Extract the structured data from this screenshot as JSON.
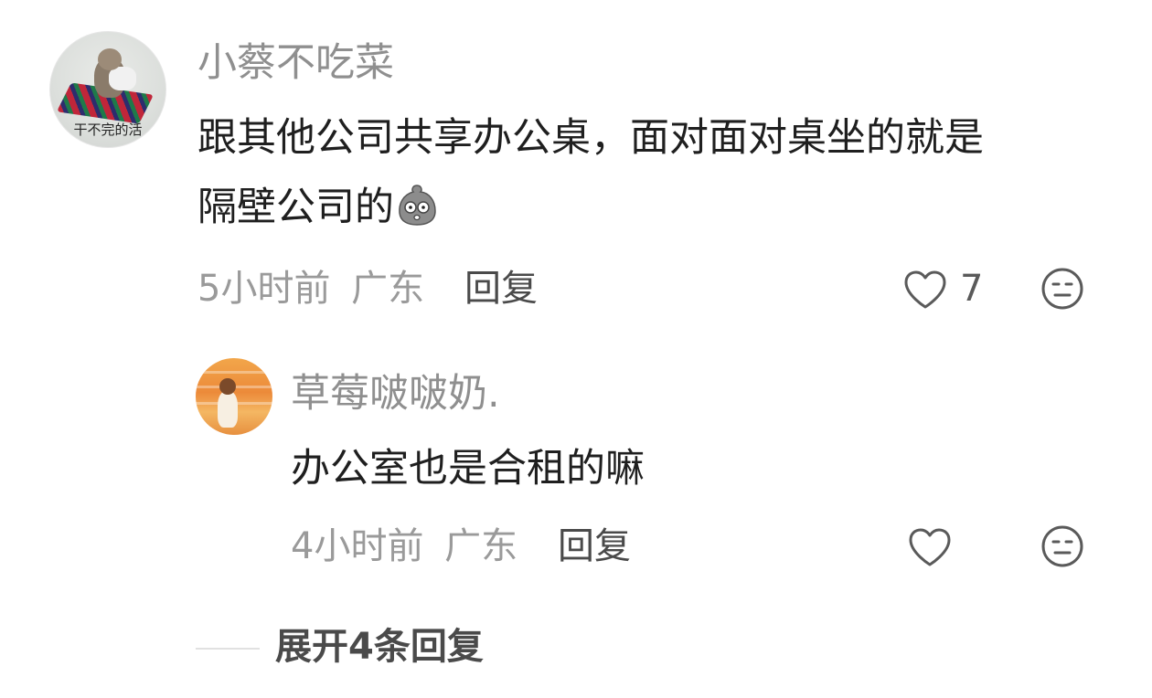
{
  "comment": {
    "avatar_caption": "干不完的活",
    "username": "小蔡不吃菜",
    "text_line1": "跟其他公司共享办公桌，面对面对桌坐的就是",
    "text_line2": "隔壁公司的",
    "emoji_icon": "stone-face-emoji",
    "time": "5小时前",
    "location": "广东",
    "reply_label": "回复",
    "like_count": "7"
  },
  "reply": {
    "username": "草莓啵啵奶.",
    "text": "办公室也是合租的嘛",
    "time": "4小时前",
    "location": "广东",
    "reply_label": "回复"
  },
  "expand": {
    "label": "展开4条回复"
  },
  "icons": {
    "like": "heart-outline-icon",
    "dislike": "meh-face-icon"
  }
}
